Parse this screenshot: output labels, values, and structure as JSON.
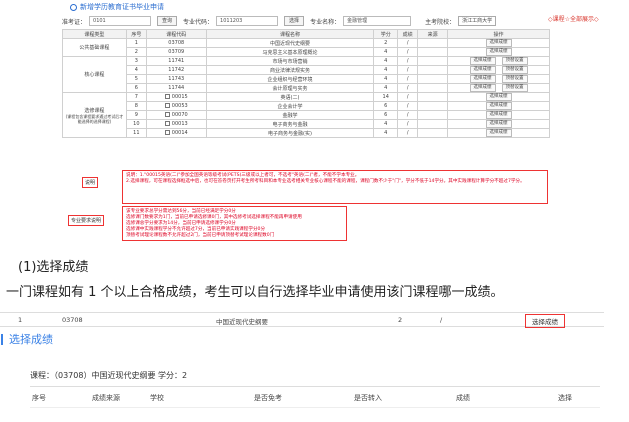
{
  "title": "新增学历教育证书毕业申请",
  "filters": {
    "zkz_label": "准考证：",
    "zkz_value": "0101",
    "btn_query": "查询",
    "major_code_label": "专业代码：",
    "major_code_value": "1011203",
    "btn_select": "选择",
    "major_name_label": "专业名称：",
    "major_name_value": "金融管理",
    "school_label": "主考院校：",
    "school_value": "浙江工商大学",
    "show_all": "◇课程☆全部展示◇"
  },
  "table": {
    "headers": [
      "课程类型",
      "序号",
      "课程代码",
      "课程名称",
      "学分",
      "成绩",
      "来源",
      "操作"
    ],
    "rows": [
      {
        "type": "公共基础课程",
        "no": "1",
        "code": "03708",
        "name": "中国近现代史纲要",
        "credit": "2",
        "score": "/",
        "src": "",
        "op": [
          "选择成绩"
        ],
        "cb": false
      },
      {
        "type": "",
        "no": "2",
        "code": "03709",
        "name": "马克思主义基本原理概论",
        "credit": "4",
        "score": "/",
        "src": "",
        "op": [
          "选择成绩"
        ],
        "cb": false
      },
      {
        "type": "核心课程",
        "no": "3",
        "code": "11741",
        "name": "市场与市场营销",
        "credit": "4",
        "score": "/",
        "src": "",
        "op": [
          "选择成绩",
          "顶替设置"
        ],
        "cb": false
      },
      {
        "type": "",
        "no": "4",
        "code": "11742",
        "name": "商业法律法规实务",
        "credit": "4",
        "score": "/",
        "src": "",
        "op": [
          "选择成绩",
          "顶替设置"
        ],
        "cb": false
      },
      {
        "type": "",
        "no": "5",
        "code": "11743",
        "name": "企业组织与经营环境",
        "credit": "4",
        "score": "/",
        "src": "",
        "op": [
          "选择成绩",
          "顶替设置"
        ],
        "cb": false
      },
      {
        "type": "",
        "no": "6",
        "code": "11744",
        "name": "会计原理与实务",
        "credit": "4",
        "score": "/",
        "src": "",
        "op": [
          "选择成绩",
          "顶替设置"
        ],
        "cb": false
      },
      {
        "type": "选修课程",
        "no": "7",
        "code": "00015",
        "name": "英语(二)",
        "credit": "14",
        "score": "/",
        "src": "",
        "op": [
          "选择成绩"
        ],
        "cb": true
      },
      {
        "type": "",
        "no": "8",
        "code": "00053",
        "name": "企业会计学",
        "credit": "6",
        "score": "/",
        "src": "",
        "op": [
          "选择成绩"
        ],
        "cb": true
      },
      {
        "type": "",
        "no": "9",
        "code": "00070",
        "name": "金融学",
        "credit": "6",
        "score": "/",
        "src": "",
        "op": [
          "选择成绩"
        ],
        "cb": true
      },
      {
        "type": "",
        "no": "10",
        "code": "00013",
        "name": "电子商务与金融",
        "credit": "4",
        "score": "/",
        "src": "",
        "op": [
          "选择成绩"
        ],
        "cb": true
      },
      {
        "type": "",
        "no": "11",
        "code": "00014",
        "name": "电子商务与金融(实)",
        "credit": "4",
        "score": "/",
        "src": "",
        "op": [
          "选择成绩"
        ],
        "cb": true
      }
    ],
    "type_note": "(课程包含课程要求通过考试后才能选择的选择课程)"
  },
  "note": {
    "label": "说明",
    "lines": [
      "说明：1.\"00015英语(二)\"参加全国英语等级考试(PETS)三级或以上者可，不选考\"英语(二)\"者，不能不学本专业。",
      "2.选择课程，可在课程选择框选中后，也可在答卷页打开考生所考科目和本专业选考相关专业核心课程不能的课程，课程门数不少于\"门\"，学分不低于14学分。其中实践课程计算学分不超过7学分。"
    ]
  },
  "req": {
    "label": "专业要求说明",
    "lines": [
      "该专业要求总学分需达到56分，当前已经满足学分0分",
      "选修课门数要求为1门，当前已申请选修课0门，其中选修考试选择课程不能再申请使用",
      "选修课总学分要求为14分，当前已申请选修课学分0分",
      "选修课中实践课程学分不允许超过7分，当前已申请实践课程学分0分",
      "顶替考试理论课程数不允许超过2门，当前已申请顶替考试理论课程数0门"
    ]
  },
  "heading": "(1)选择成绩",
  "paragraph": "一门课程如有 1 个以上合格成绩，考生可以自行选择毕业申请使用该门课程哪一成绩。",
  "strip": {
    "no": "1",
    "code": "03708",
    "name": "中国近现代史纲要",
    "credit": "2",
    "score": "/",
    "btn": "选择成绩"
  },
  "section_title": "选择成绩",
  "course_info": "课程：（03708）中国近现代史纲要   学分：2",
  "sub_headers": [
    "序号",
    "成绩来源",
    "学校",
    "是否免考",
    "是否转入",
    "成绩",
    "选择"
  ]
}
